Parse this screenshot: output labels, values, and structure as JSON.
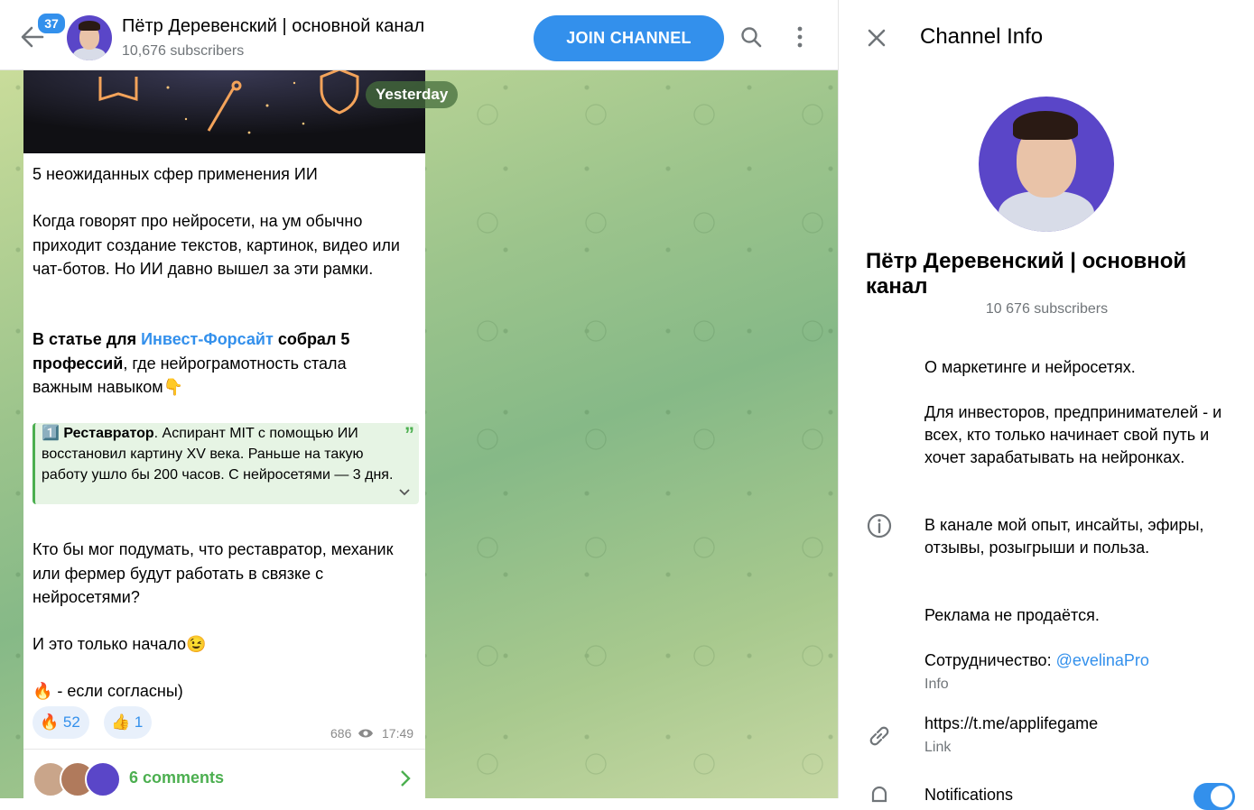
{
  "header": {
    "unread_count": "37",
    "channel_name": "Пётр Деревенский | основной канал",
    "subscribers": "10,676 subscribers",
    "join_label": "JOIN CHANNEL"
  },
  "chat": {
    "date_badge": "Yesterday",
    "post": {
      "title": "5 неожиданных сфер применения ИИ",
      "p1": "Когда говорят про нейросети, на ум обычно приходит создание текстов, картинок, видео или чат-ботов. Но ИИ давно вышел за эти рамки.",
      "p2_a": "В статье для ",
      "p2_link": "Инвест-Форсайт",
      "p2_b": " собрал 5 профессий",
      "p2_c": ", где нейрограмотность стала важным навыком👇",
      "quote_num": "1️⃣",
      "quote_bold": "Реставратор",
      "quote_text": ". Аспирант MIT с помощью ИИ восстановил картину XV века. Раньше на такую работу ушло бы 200 часов. С нейросетями — 3 дня.",
      "p3": "Кто бы мог подумать, что реставратор, механик или фермер будут работать в связке с нейросетями?",
      "p4": "И это только начало😉",
      "p5": "🔥 - если согласны)",
      "reactions": [
        {
          "emoji": "🔥",
          "count": "52"
        },
        {
          "emoji": "👍",
          "count": "1"
        }
      ],
      "views": "686",
      "time": "17:49",
      "comments": "6 comments"
    }
  },
  "panel": {
    "title": "Channel Info",
    "name": "Пётр Деревенский | основной канал",
    "subscribers": "10 676 subscribers",
    "about_1": "О маркетинге и нейросетях.",
    "about_2": "Для инвесторов, предпринимателей - и всех, кто только начинает свой путь и хочет зарабатывать на нейронках.",
    "about_3": "В канале мой опыт, инсайты, эфиры, отзывы, розыгрыши и польза.",
    "about_4": "Реклама не продаётся.",
    "about_5_text": "Сотрудничество: ",
    "about_5_link": "@evelinaPro",
    "info_label": "Info",
    "link_value": "https://t.me/applifegame",
    "link_label": "Link",
    "notifications_label": "Notifications"
  },
  "colors": {
    "accent": "#3390ec",
    "green": "#4caf50"
  },
  "icons": [
    "back-arrow-icon",
    "search-icon",
    "more-vertical-icon",
    "close-icon",
    "info-icon",
    "link-icon",
    "bell-icon",
    "eye-icon",
    "chevron-right-icon",
    "chevron-down-icon"
  ]
}
